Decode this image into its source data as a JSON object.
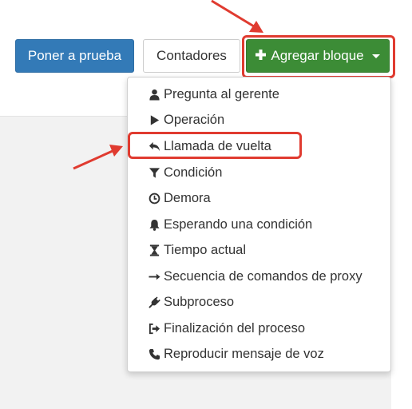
{
  "toolbar": {
    "test_label": "Poner a prueba",
    "counters_label": "Contadores",
    "add_block_label": "Agregar bloque"
  },
  "menu": {
    "items": [
      {
        "label": "Pregunta al gerente",
        "icon": "user-icon"
      },
      {
        "label": "Operación",
        "icon": "play-icon"
      },
      {
        "label": "Llamada de vuelta",
        "icon": "reply-icon"
      },
      {
        "label": "Condición",
        "icon": "filter-icon"
      },
      {
        "label": "Demora",
        "icon": "clock-icon"
      },
      {
        "label": "Esperando una condición",
        "icon": "bell-icon"
      },
      {
        "label": "Tiempo actual",
        "icon": "hourglass-icon"
      },
      {
        "label": "Secuencia de comandos de proxy",
        "icon": "arrow-right-icon"
      },
      {
        "label": "Subproceso",
        "icon": "plug-icon"
      },
      {
        "label": "Finalización del proceso",
        "icon": "sign-out-icon"
      },
      {
        "label": "Reproducir mensaje de voz",
        "icon": "phone-icon"
      }
    ]
  },
  "colors": {
    "primary_button": "#337ab7",
    "success_button": "#3c8c36",
    "highlight": "#e03b30"
  }
}
